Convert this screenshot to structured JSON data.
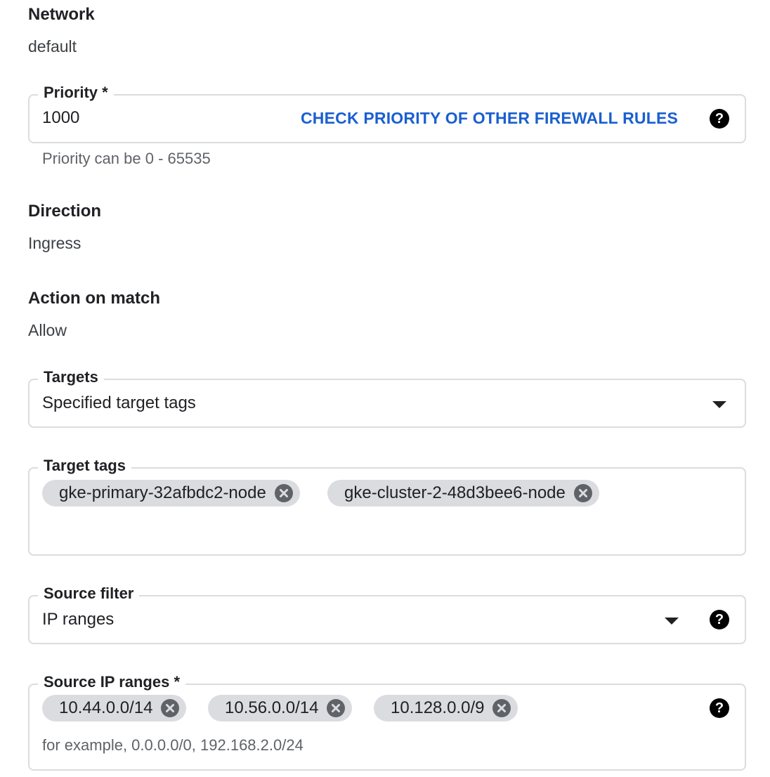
{
  "network": {
    "label": "Network",
    "value": "default"
  },
  "priority": {
    "label": "Priority *",
    "value": "1000",
    "check_button": "CHECK PRIORITY OF OTHER FIREWALL RULES",
    "help_icon": "help-icon",
    "hint": "Priority can be 0 - 65535"
  },
  "direction": {
    "label": "Direction",
    "value": "Ingress"
  },
  "action": {
    "label": "Action on match",
    "value": "Allow"
  },
  "targets": {
    "label": "Targets",
    "value": "Specified target tags",
    "icon": "dropdown-arrow-icon"
  },
  "target_tags": {
    "label": "Target tags",
    "chips": [
      "gke-primary-32afbdc2-node",
      "gke-cluster-2-48d3bee6-node"
    ],
    "chip_remove_icon": "cancel-icon"
  },
  "source_filter": {
    "label": "Source filter",
    "value": "IP ranges",
    "icon": "dropdown-arrow-icon",
    "help_icon": "help-icon"
  },
  "source_ip_ranges": {
    "label": "Source IP ranges *",
    "chips": [
      "10.44.0.0/14",
      "10.56.0.0/14",
      "10.128.0.0/9"
    ],
    "hint": "for example, 0.0.0.0/0, 192.168.2.0/24",
    "help_icon": "help-icon"
  },
  "colors": {
    "link": "#1a5fd0",
    "chip_background": "#dadce0",
    "border": "#dadce0"
  }
}
